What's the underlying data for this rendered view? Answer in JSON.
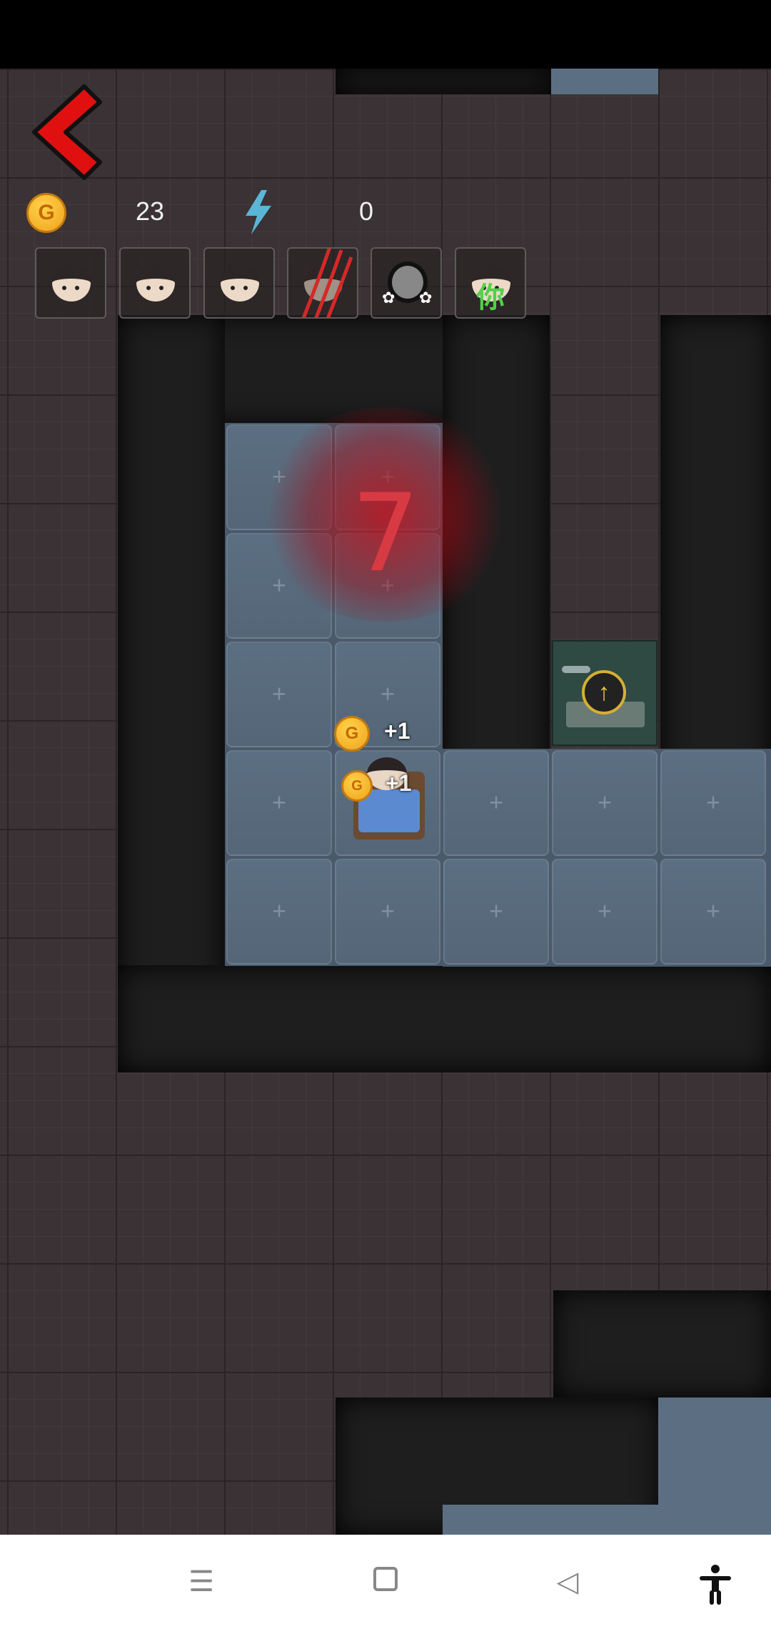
{
  "hud": {
    "gold": "23",
    "energy": "0",
    "gold_coin_glyph": "G",
    "back_icon": "chevron-left-icon",
    "energy_icon": "lightning-icon"
  },
  "players": [
    {
      "name": "player-1",
      "icon": "girl-avatar-icon"
    },
    {
      "name": "player-2",
      "icon": "girl-avatar-icon"
    },
    {
      "name": "player-3",
      "icon": "girl-avatar-icon"
    },
    {
      "name": "player-4",
      "icon": "attacked-avatar-icon"
    },
    {
      "name": "ghost",
      "icon": "ghost-avatar-icon"
    },
    {
      "name": "you",
      "icon": "girl-avatar-icon",
      "label": "你"
    }
  ],
  "board": {
    "countdown": "7",
    "gold_gain_1": "+1",
    "gold_gain_2": "+1",
    "upgrade_icon": "arrow-up-icon"
  },
  "nav": {
    "menu_icon": "menu-icon",
    "home_icon": "home-icon",
    "back_icon": "back-triangle-icon",
    "accessibility_icon": "accessibility-icon"
  },
  "colors": {
    "countdown": "#d83a44",
    "you_label": "#4fd24a",
    "back_arrow": "#e01010"
  }
}
